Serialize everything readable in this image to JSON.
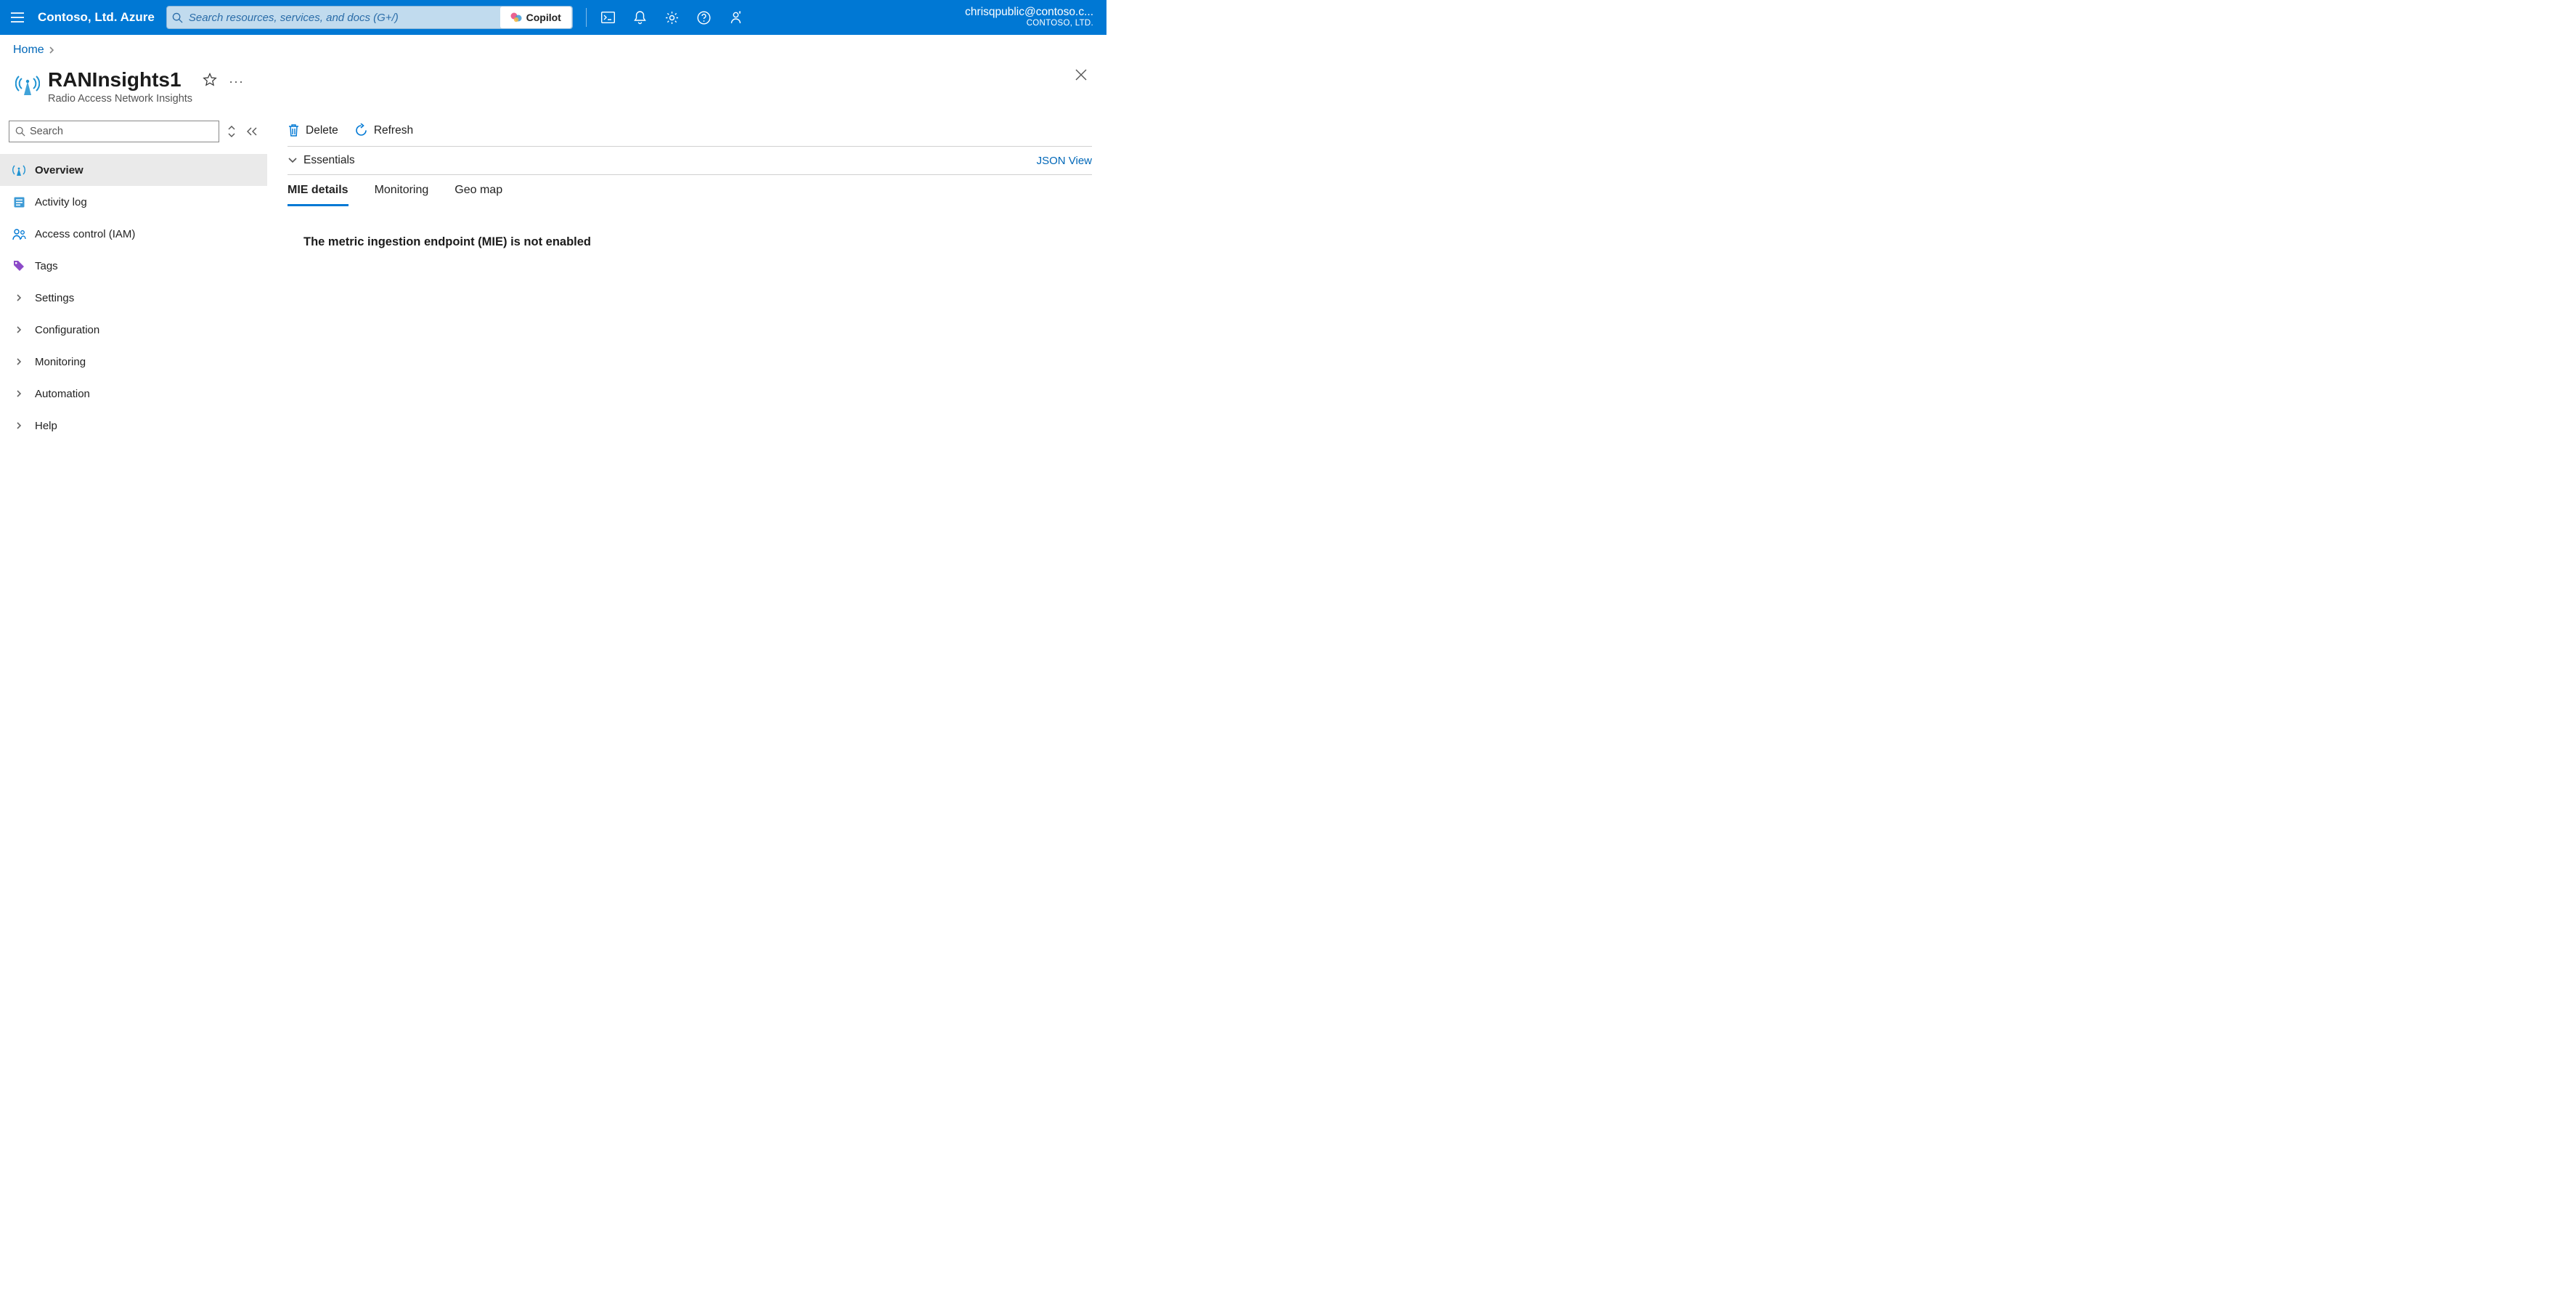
{
  "topbar": {
    "brand": "Contoso, Ltd. Azure",
    "search_placeholder": "Search resources, services, and docs (G+/)",
    "copilot_label": "Copilot",
    "account_email": "chrisqpublic@contoso.c...",
    "account_tenant": "CONTOSO, LTD."
  },
  "breadcrumb": {
    "items": [
      "Home"
    ]
  },
  "page": {
    "title": "RANInsights1",
    "subtitle": "Radio Access Network Insights"
  },
  "sidebar": {
    "search_placeholder": "Search",
    "items": [
      {
        "icon": "antenna-icon",
        "label": "Overview",
        "active": true
      },
      {
        "icon": "log-icon",
        "label": "Activity log"
      },
      {
        "icon": "people-icon",
        "label": "Access control (IAM)"
      },
      {
        "icon": "tag-icon",
        "label": "Tags"
      },
      {
        "icon": "chevron-right-icon",
        "label": "Settings"
      },
      {
        "icon": "chevron-right-icon",
        "label": "Configuration"
      },
      {
        "icon": "chevron-right-icon",
        "label": "Monitoring"
      },
      {
        "icon": "chevron-right-icon",
        "label": "Automation"
      },
      {
        "icon": "chevron-right-icon",
        "label": "Help"
      }
    ]
  },
  "toolbar": {
    "delete_label": "Delete",
    "refresh_label": "Refresh"
  },
  "essentials": {
    "label": "Essentials",
    "json_view_label": "JSON View"
  },
  "tabs": [
    {
      "label": "MIE details",
      "active": true
    },
    {
      "label": "Monitoring"
    },
    {
      "label": "Geo map"
    }
  ],
  "content": {
    "message": "The metric ingestion endpoint (MIE) is not enabled"
  }
}
